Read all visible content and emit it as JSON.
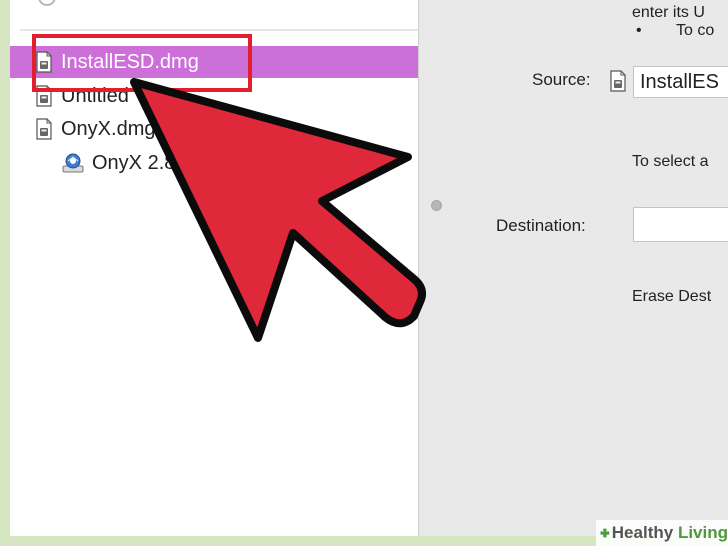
{
  "sidebar": {
    "items": [
      {
        "label": "InstallESD.dmg",
        "icon": "disk-image-file-icon",
        "selected": true
      },
      {
        "label": "Untitled",
        "icon": "disk-image-file-icon",
        "selected": false
      },
      {
        "label": "OnyX.dmg",
        "icon": "disk-image-file-icon",
        "selected": false
      },
      {
        "label": "OnyX 2.8",
        "icon": "mounted-volume-icon",
        "selected": false
      }
    ]
  },
  "right_panel": {
    "info_line_1": "enter its U",
    "info_bullet": "•",
    "info_line_2": "To co",
    "source_label": "Source:",
    "source_value": "InstallES",
    "select_text": "To select a",
    "destination_label": "Destination:",
    "destination_value": "",
    "erase_text": "Erase Dest"
  },
  "colors": {
    "selection": "#cc6fd9",
    "highlight_box": "#e21f2d",
    "arrow_fill": "#e0283b",
    "background_border": "#d6e6c3"
  },
  "watermark": {
    "prefix": "Healthy",
    "accent": "Living"
  }
}
